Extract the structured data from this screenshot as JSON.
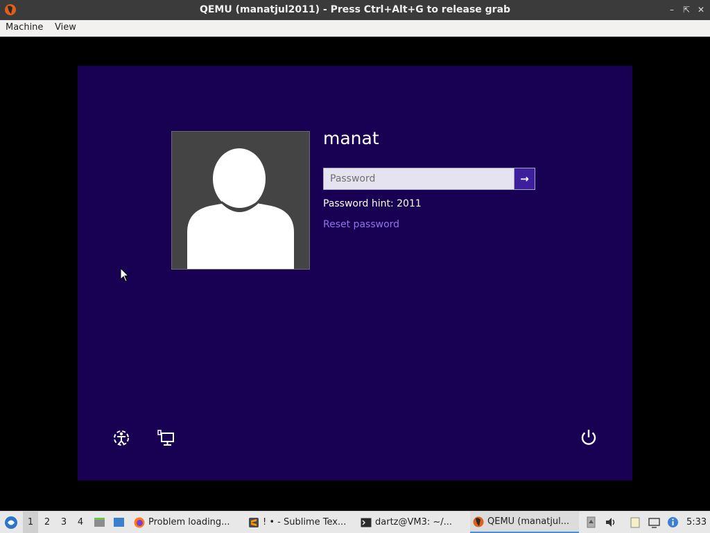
{
  "window": {
    "title": "QEMU (manatjul2011) - Press Ctrl+Alt+G to release grab",
    "app_icon": "qemu-icon",
    "controls": [
      "minimize-icon",
      "restore-icon",
      "close-icon"
    ]
  },
  "menubar": {
    "items": [
      "Machine",
      "View"
    ]
  },
  "lockscreen": {
    "username": "manat",
    "password_placeholder": "Password",
    "password_value": "",
    "submit_icon": "arrow-right-icon",
    "hint": "Password hint: 2011",
    "reset_link": "Reset password",
    "bottom_icons": [
      "ease-of-access-icon",
      "network-icon",
      "power-icon"
    ],
    "colors": {
      "background": "#180052",
      "accent": "#3d1e9c",
      "link": "#8f74ec"
    }
  },
  "taskbar": {
    "start_icon": "start-menu-icon",
    "workspaces": [
      "1",
      "2",
      "3",
      "4"
    ],
    "active_workspace": "1",
    "launchers": [
      "file-manager-icon",
      "desktop-icon"
    ],
    "tasks": [
      {
        "label": "Problem loading...",
        "icon": "firefox-icon"
      },
      {
        "label": "! • - Sublime Tex...",
        "icon": "sublime-text-icon"
      },
      {
        "label": "dartz@VM3: ~/...",
        "icon": "terminal-icon"
      },
      {
        "label": "QEMU (manatjul...",
        "icon": "qemu-icon"
      }
    ],
    "active_task": "QEMU (manatjul...",
    "tray_icons": [
      "clipboard-icon",
      "volume-icon",
      "notes-icon",
      "network-icon",
      "info-icon"
    ],
    "clock": "5:33"
  }
}
